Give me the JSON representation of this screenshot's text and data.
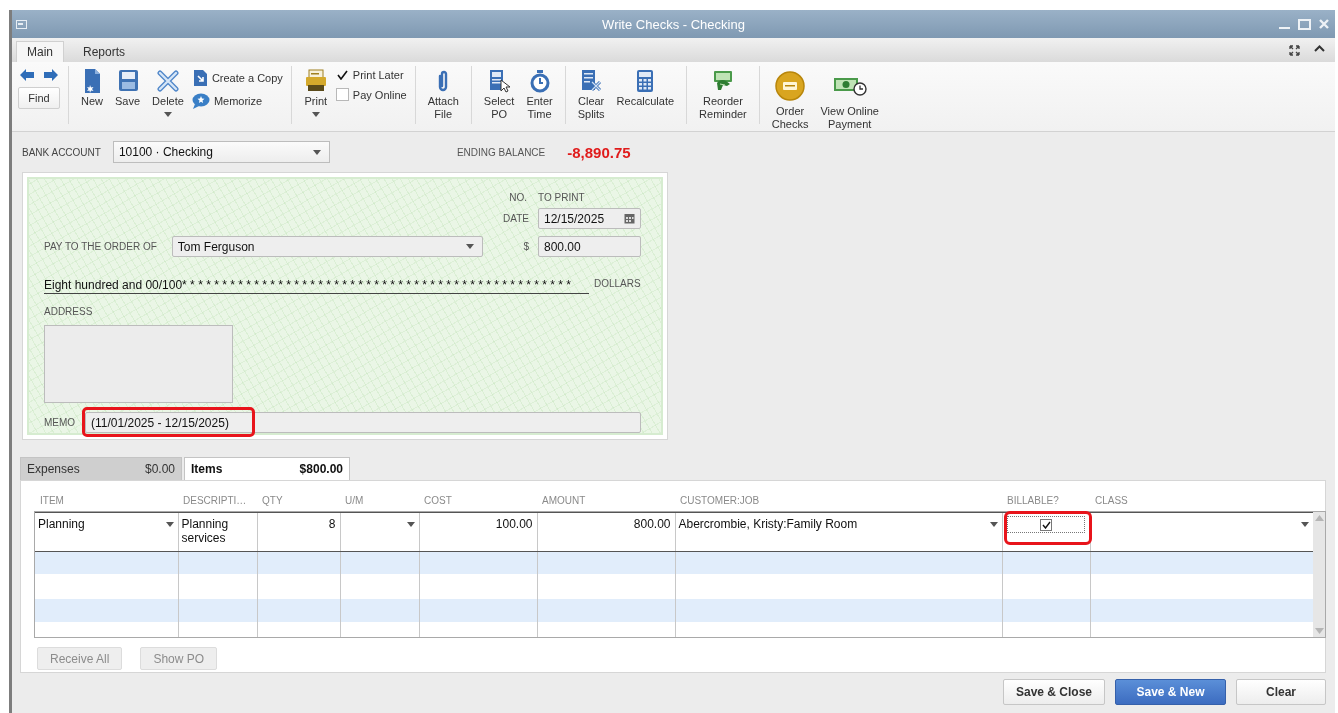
{
  "window": {
    "title": "Write Checks - Checking"
  },
  "ribbon_tabs": [
    {
      "label": "Main",
      "selected": true
    },
    {
      "label": "Reports",
      "selected": false
    }
  ],
  "toolbar": [
    {
      "items": [
        {
          "kind": "nav",
          "label": "Find"
        }
      ]
    },
    {
      "items": [
        {
          "kind": "large",
          "label": "New"
        },
        {
          "kind": "large",
          "label": "Save"
        },
        {
          "kind": "large",
          "label": "Delete",
          "dropdown": true
        },
        {
          "kind": "stack",
          "items": [
            {
              "label": "Create a Copy"
            },
            {
              "label": "Memorize"
            }
          ]
        }
      ]
    },
    {
      "items": [
        {
          "kind": "large",
          "label": "Print",
          "dropdown": true
        },
        {
          "kind": "checks",
          "items": [
            {
              "label": "Print Later",
              "checked": true
            },
            {
              "label": "Pay Online",
              "checked": false
            }
          ]
        }
      ]
    },
    {
      "items": [
        {
          "kind": "large",
          "label": "Attach\nFile"
        }
      ]
    },
    {
      "items": [
        {
          "kind": "large",
          "label": "Select\nPO"
        },
        {
          "kind": "large",
          "label": "Enter\nTime"
        }
      ]
    },
    {
      "items": [
        {
          "kind": "large",
          "label": "Clear\nSplits"
        },
        {
          "kind": "large",
          "label": "Recalculate"
        }
      ]
    },
    {
      "items": [
        {
          "kind": "large",
          "label": "Reorder\nReminder"
        }
      ]
    },
    {
      "items": [
        {
          "kind": "large",
          "label": "Order\nChecks"
        },
        {
          "kind": "large",
          "label": "View Online\nPayment"
        }
      ]
    }
  ],
  "bank_account": {
    "label": "BANK ACCOUNT",
    "value": "10100 · Checking"
  },
  "ending_balance": {
    "label": "ENDING BALANCE",
    "value": "-8,890.75"
  },
  "check": {
    "no_label": "NO.",
    "no_value": "TO PRINT",
    "date_label": "DATE",
    "date": "12/15/2025",
    "pay_label": "PAY TO THE ORDER OF",
    "payee": "Tom Ferguson",
    "currency": "$",
    "amount": "800.00",
    "amount_words": "Eight hundred and 00/100* * * * * * * * * * * * * * * * * * * * * * * * * * * * * * * * * * * * * * * * * * * * * * * * *",
    "dollars_label": "DOLLARS",
    "address_label": "ADDRESS",
    "memo_label": "MEMO",
    "memo": "(11/01/2025 - 12/15/2025)",
    "memo_highlighted": true
  },
  "split_tabs": [
    {
      "label": "Expenses",
      "amount": "$0.00",
      "selected": false
    },
    {
      "label": "Items",
      "amount": "$800.00",
      "selected": true
    }
  ],
  "items_grid": {
    "columns": [
      {
        "label": "ITEM"
      },
      {
        "label": "DESCRIPTI…"
      },
      {
        "label": "QTY"
      },
      {
        "label": "U/M"
      },
      {
        "label": "COST"
      },
      {
        "label": "AMOUNT"
      },
      {
        "label": "CUSTOMER:JOB"
      },
      {
        "label": "BILLABLE?"
      },
      {
        "label": "CLASS"
      }
    ],
    "rows": [
      {
        "item": "Planning",
        "description": "Planning services",
        "qty": "8",
        "cost": "100.00",
        "amount": "800.00",
        "customer_job": "Abercrombie, Kristy:Family Room",
        "billable": true,
        "billable_highlighted": true
      }
    ]
  },
  "grid_buttons": [
    {
      "label": "Receive All",
      "disabled": true
    },
    {
      "label": "Show PO",
      "disabled": true
    }
  ],
  "footer_buttons": [
    {
      "label": "Save & Close",
      "primary": false
    },
    {
      "label": "Save & New",
      "primary": true
    },
    {
      "label": "Clear",
      "primary": false
    }
  ]
}
